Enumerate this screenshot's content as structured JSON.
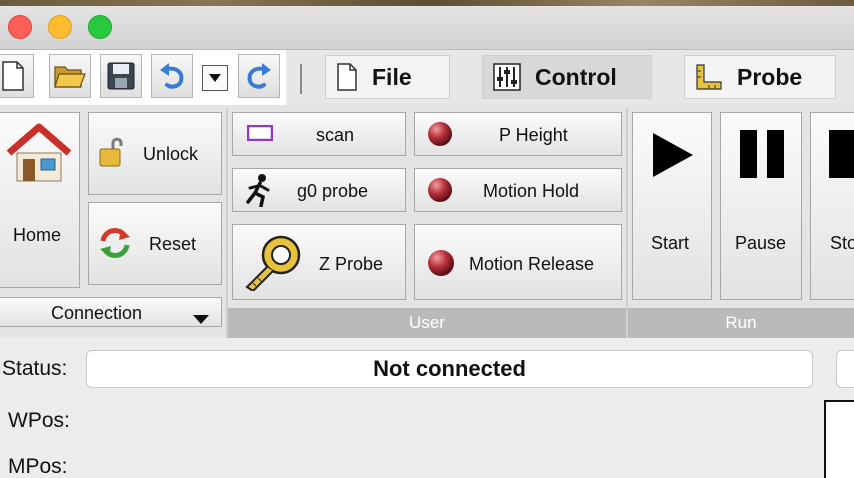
{
  "window": {
    "traffic_lights": [
      "close",
      "minimize",
      "zoom"
    ],
    "colors": {
      "close": "#fe5f57",
      "minimize": "#febc2e",
      "zoom": "#28c840"
    }
  },
  "toolbar": {
    "quick_access": [
      "new-document-icon",
      "open-folder-icon",
      "save-disk-icon",
      "undo-icon",
      "dropdown-icon",
      "redo-icon"
    ],
    "tabs": [
      {
        "label": "File",
        "icon": "document-icon"
      },
      {
        "label": "Control",
        "icon": "sliders-icon"
      },
      {
        "label": "Probe",
        "icon": "ruler-square-icon"
      }
    ]
  },
  "ribbon": {
    "connection": {
      "home_label": "Home",
      "unlock_label": "Unlock",
      "reset_label": "Reset",
      "dropdown_label": "Connection"
    },
    "user": {
      "group_label": "User",
      "buttons": [
        {
          "label": "scan",
          "icon": "rectangle-icon"
        },
        {
          "label": "g0 probe",
          "icon": "running-man-icon"
        },
        {
          "label": "Z Probe",
          "icon": "tape-measure-icon"
        },
        {
          "label": "P Height",
          "icon": "red-ball-icon"
        },
        {
          "label": "Motion Hold",
          "icon": "red-ball-icon"
        },
        {
          "label": "Motion Release",
          "icon": "red-ball-icon"
        }
      ]
    },
    "run": {
      "group_label": "Run",
      "buttons": [
        {
          "label": "Start",
          "icon": "play-icon"
        },
        {
          "label": "Pause",
          "icon": "pause-icon"
        },
        {
          "label": "Sto",
          "icon": "stop-icon"
        }
      ]
    }
  },
  "status": {
    "status_label": "Status:",
    "status_value": "Not connected",
    "wpos_label": "WPos:",
    "mpos_label": "MPos:"
  }
}
